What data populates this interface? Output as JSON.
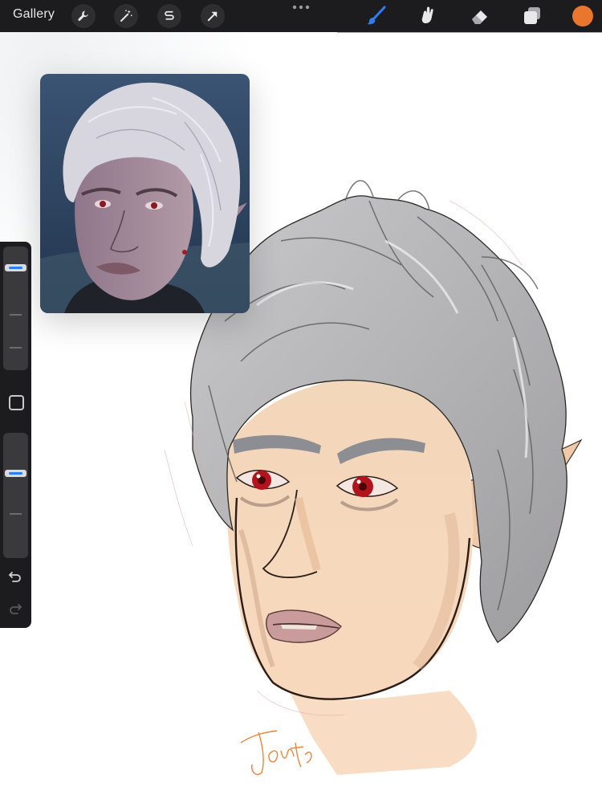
{
  "toolbar": {
    "gallery_label": "Gallery",
    "left_tools": [
      "wrench-icon",
      "magic-wand-icon",
      "selection-icon",
      "transform-arrow-icon"
    ],
    "right_tools": [
      "brush-icon",
      "smudge-icon",
      "eraser-icon",
      "layers-icon"
    ],
    "active_tool": "brush-icon",
    "active_tool_color": "#2f7cf6",
    "current_color": "#e8762d"
  },
  "sidebar": {
    "brush_size_level": 0.86,
    "opacity_level": 0.69,
    "modify_button": "square-icon",
    "undo": "undo-icon",
    "redo": "redo-icon"
  },
  "canvas": {
    "reference_image": "reference-photo-silver-haired-elf",
    "artwork": "digital-sketch-silver-haired-elf-portrait",
    "signature": "handwritten-signature"
  }
}
